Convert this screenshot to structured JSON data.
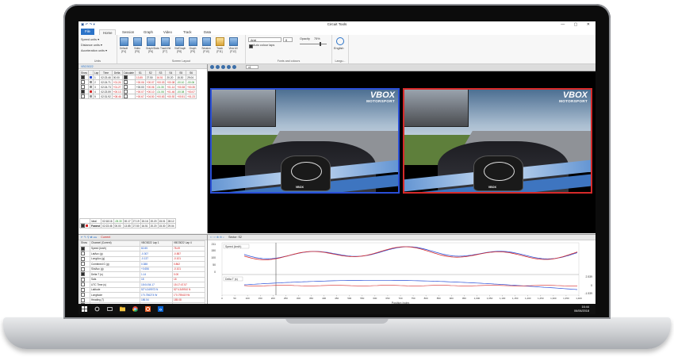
{
  "window": {
    "title": "Circuit Tools",
    "controls": "—  ▢  ✕"
  },
  "qat": "▣ ↶ ↷ ▾",
  "ribbon_tabs": [
    {
      "label": "File"
    },
    {
      "label": "Home"
    },
    {
      "label": "Session"
    },
    {
      "label": "Graph"
    },
    {
      "label": "Video"
    },
    {
      "label": "Track"
    },
    {
      "label": "Data"
    }
  ],
  "ribbon": {
    "units": {
      "items": [
        "Speed units ▾",
        "Distance units ▾",
        "Acceleration units ▾"
      ],
      "label": "Units"
    },
    "layout": {
      "buttons": [
        {
          "label": "Default",
          "key": "[F4]"
        },
        {
          "label": "Video",
          "key": "[F5]"
        },
        {
          "label": "Graph/Data",
          "key": "[F6]"
        },
        {
          "label": "Track/Vid",
          "key": "[F7]"
        },
        {
          "label": "Vid/Graph",
          "key": "[F8]"
        },
        {
          "label": "Graph",
          "key": "[F9]"
        },
        {
          "label": "Session",
          "key": "[F10]"
        },
        {
          "label": "Track",
          "key": "[F11]"
        },
        {
          "label": "View All",
          "key": "[F12]"
        }
      ],
      "label": "Screen Layout"
    },
    "fonts": {
      "font": "Arial",
      "size": "8",
      "opacity_label": "Opacity",
      "opacity_value": "75%",
      "auto_colour_label": "Auto colour laps",
      "label": "Fonts and colours"
    },
    "language": {
      "value": "English",
      "label": "Langu..."
    }
  },
  "laps_panel": {
    "tab_label": "VBO3022",
    "headers": [
      "Show",
      "",
      "Lap",
      "Time",
      "Delta",
      "Calculate",
      "S1",
      "S2",
      "S3",
      "S4",
      "S5",
      "S6"
    ],
    "rows": [
      {
        "lap": "1",
        "time": "02:23.46",
        "delta": "00.00",
        "s1": "13.85",
        "s2": "27.50",
        "s3": "16.51",
        "s4": "20.20",
        "s5": "15.30",
        "s6": "29.04"
      },
      {
        "lap": "2",
        "time": "02:24.71",
        "delta": "+01.24",
        "s1": "+00.06",
        "s2": "+00.07",
        "s3": "+00.03",
        "s4": "+00.08",
        "s5": "-00.10",
        "s6": "-00.06"
      },
      {
        "lap": "3",
        "time": "02:24.73",
        "delta": "+01.27",
        "s1": "+00.00",
        "s2": "+00.06",
        "s3": "-01.35",
        "s4": "+01.14",
        "s5": "+00.38",
        "s6": "+00.35"
      },
      {
        "lap": "4",
        "time": "02:23.59",
        "delta": "+00.13",
        "s1": "+00.07",
        "s2": "+00.10",
        "s3": "-01.08",
        "s4": "+01.46",
        "s5": "-00.08",
        "s6": "+00.07"
      },
      {
        "lap": "5",
        "time": "02:31.92",
        "delta": "+08.46",
        "s1": "+00.67",
        "s2": "+04.50",
        "s3": "+00.63",
        "s4": "+00.92",
        "s5": "+00.51",
        "s6": "+01.23"
      }
    ],
    "ideal": {
      "label": "Ideal",
      "time": "02:18.16",
      "delta": "-05.30",
      "s1": "00.17",
      "s2": "27.19",
      "s3": "15.16",
      "s4": "20.20",
      "s5": "15.01",
      "s6": "28.12"
    },
    "fastest": {
      "label": "Fastest",
      "lap": "1",
      "time": "02:23.46",
      "delta": "00.00",
      "s1": "13.85",
      "s2": "27.50",
      "s3": "16.51",
      "s4": "20.20",
      "s5": "15.30",
      "s6": "29.04"
    }
  },
  "video_toolbar": {
    "speed": "x1"
  },
  "videos": [
    {
      "brand": "VBOX",
      "sub": "MOTORSPORT",
      "dash": "VBOX"
    },
    {
      "brand": "VBOX",
      "sub": "MOTORSPORT",
      "dash": "VBOX"
    }
  ],
  "channels_panel": {
    "toolbar": "Current",
    "headers": {
      "show": "Show",
      "channel": "Channel (Current)",
      "col1": "VBO3022 Lap 1",
      "col2": "VBO3022 Lap 4"
    },
    "rows": [
      {
        "name": "Speed (km/h)",
        "v1": "82.85",
        "v2": "78.49",
        "on": true
      },
      {
        "name": "LatAcc (g)",
        "v1": "-0.307",
        "v2": "-0.857",
        "on": false
      },
      {
        "name": "LongAcc (g)",
        "v1": "-0.137",
        "v2": "-0.101",
        "on": false
      },
      {
        "name": "Combined G (g)",
        "v1": "0.388",
        "v2": "0.862",
        "on": false
      },
      {
        "name": "SlotAcc (g)",
        "v1": "+0.656",
        "v2": "-0.101",
        "on": false
      },
      {
        "name": "Delta T (s)",
        "v1": "1.14",
        "v2": "0.00",
        "on": true
      },
      {
        "name": "Sats",
        "v1": "18",
        "v2": "18",
        "on": false
      },
      {
        "name": "UTC Time (s)",
        "v1": "15:04:54.17",
        "v2": "15:17:47.57",
        "on": false
      },
      {
        "name": "Latitude",
        "v1": "52°4.349973 N",
        "v2": "52°4.349910 N",
        "on": false
      },
      {
        "name": "Longitude",
        "v1": "1°0.756274 W",
        "v2": "1°0.795419 W",
        "on": false
      },
      {
        "name": "Heading (°)",
        "v1": "186.54",
        "v2": "185.08",
        "on": false
      },
      {
        "name": "Height (m)",
        "v1": "157.01",
        "v2": "156.74",
        "on": false
      },
      {
        "name": "Vertical vel (km/h)",
        "v1": "-0.01",
        "v2": "-0.35",
        "on": false
      },
      {
        "name": "Height (m)",
        "v1": "157.01",
        "v2": "156.74",
        "on": false
      }
    ]
  },
  "graph": {
    "sector_label": "Sector: S2",
    "speed_label": "Speed (km/h)",
    "delta_label": "Delta T (s)",
    "xlabel": "Position Index",
    "x_ticks": [
      "0",
      "50",
      "100",
      "150",
      "200",
      "250",
      "300",
      "350",
      "400",
      "450",
      "500",
      "550",
      "600",
      "650",
      "700",
      "750",
      "800",
      "850",
      "900",
      "950",
      "1,000",
      "1,050",
      "1,100",
      "1,150",
      "1,200",
      "1,250",
      "1,300",
      "1,350",
      "1,400"
    ],
    "left_ticks": [
      "211",
      "150",
      "100",
      "50",
      "0"
    ],
    "right_ticks": [
      "2.539",
      "0",
      "-1.539"
    ]
  },
  "taskbar": {
    "time": "16:44",
    "date": "06/06/2018"
  }
}
